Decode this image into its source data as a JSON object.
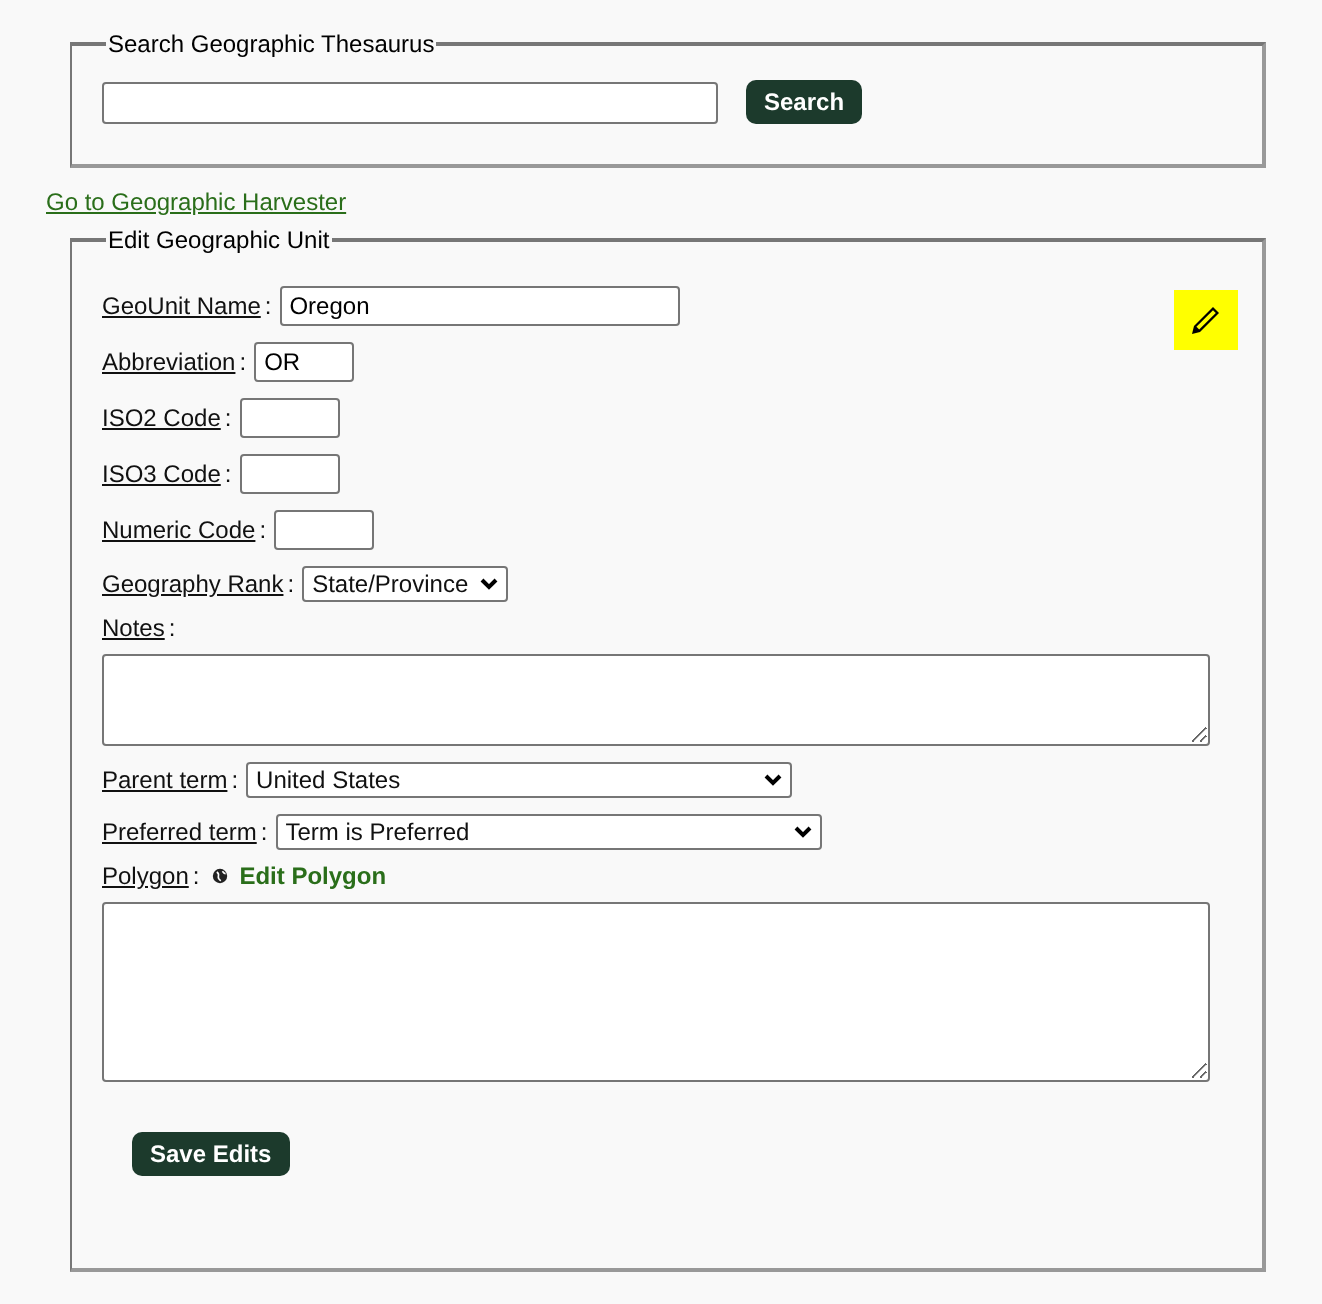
{
  "search_panel": {
    "legend": "Search Geographic Thesaurus",
    "button": "Search"
  },
  "harvester_link": "Go to Geographic Harvester",
  "edit_panel": {
    "legend": "Edit Geographic Unit",
    "fields": [
      {
        "kind": "text",
        "label": "GeoUnit Name",
        "colon": ":",
        "value": "Oregon"
      },
      {
        "kind": "text",
        "label": "Abbreviation",
        "colon": ":",
        "value": "OR"
      },
      {
        "kind": "text",
        "label": "ISO2 Code",
        "colon": ":"
      },
      {
        "kind": "text",
        "label": "ISO3 Code",
        "colon": ":"
      },
      {
        "kind": "text",
        "label": "Numeric Code",
        "colon": ":"
      },
      {
        "kind": "select",
        "label": "Geography Rank",
        "colon": ":",
        "value": "State/Province"
      },
      {
        "kind": "textarea",
        "label": "Notes",
        "colon": ":"
      },
      {
        "kind": "select",
        "label": "Parent term",
        "colon": ":",
        "value": "United States"
      },
      {
        "kind": "select",
        "label": "Preferred term",
        "colon": ":",
        "value": "Term is Preferred"
      },
      {
        "kind": "textarea",
        "label": "Polygon",
        "colon": ":",
        "link": "Edit Polygon"
      }
    ],
    "save_button": "Save Edits"
  }
}
